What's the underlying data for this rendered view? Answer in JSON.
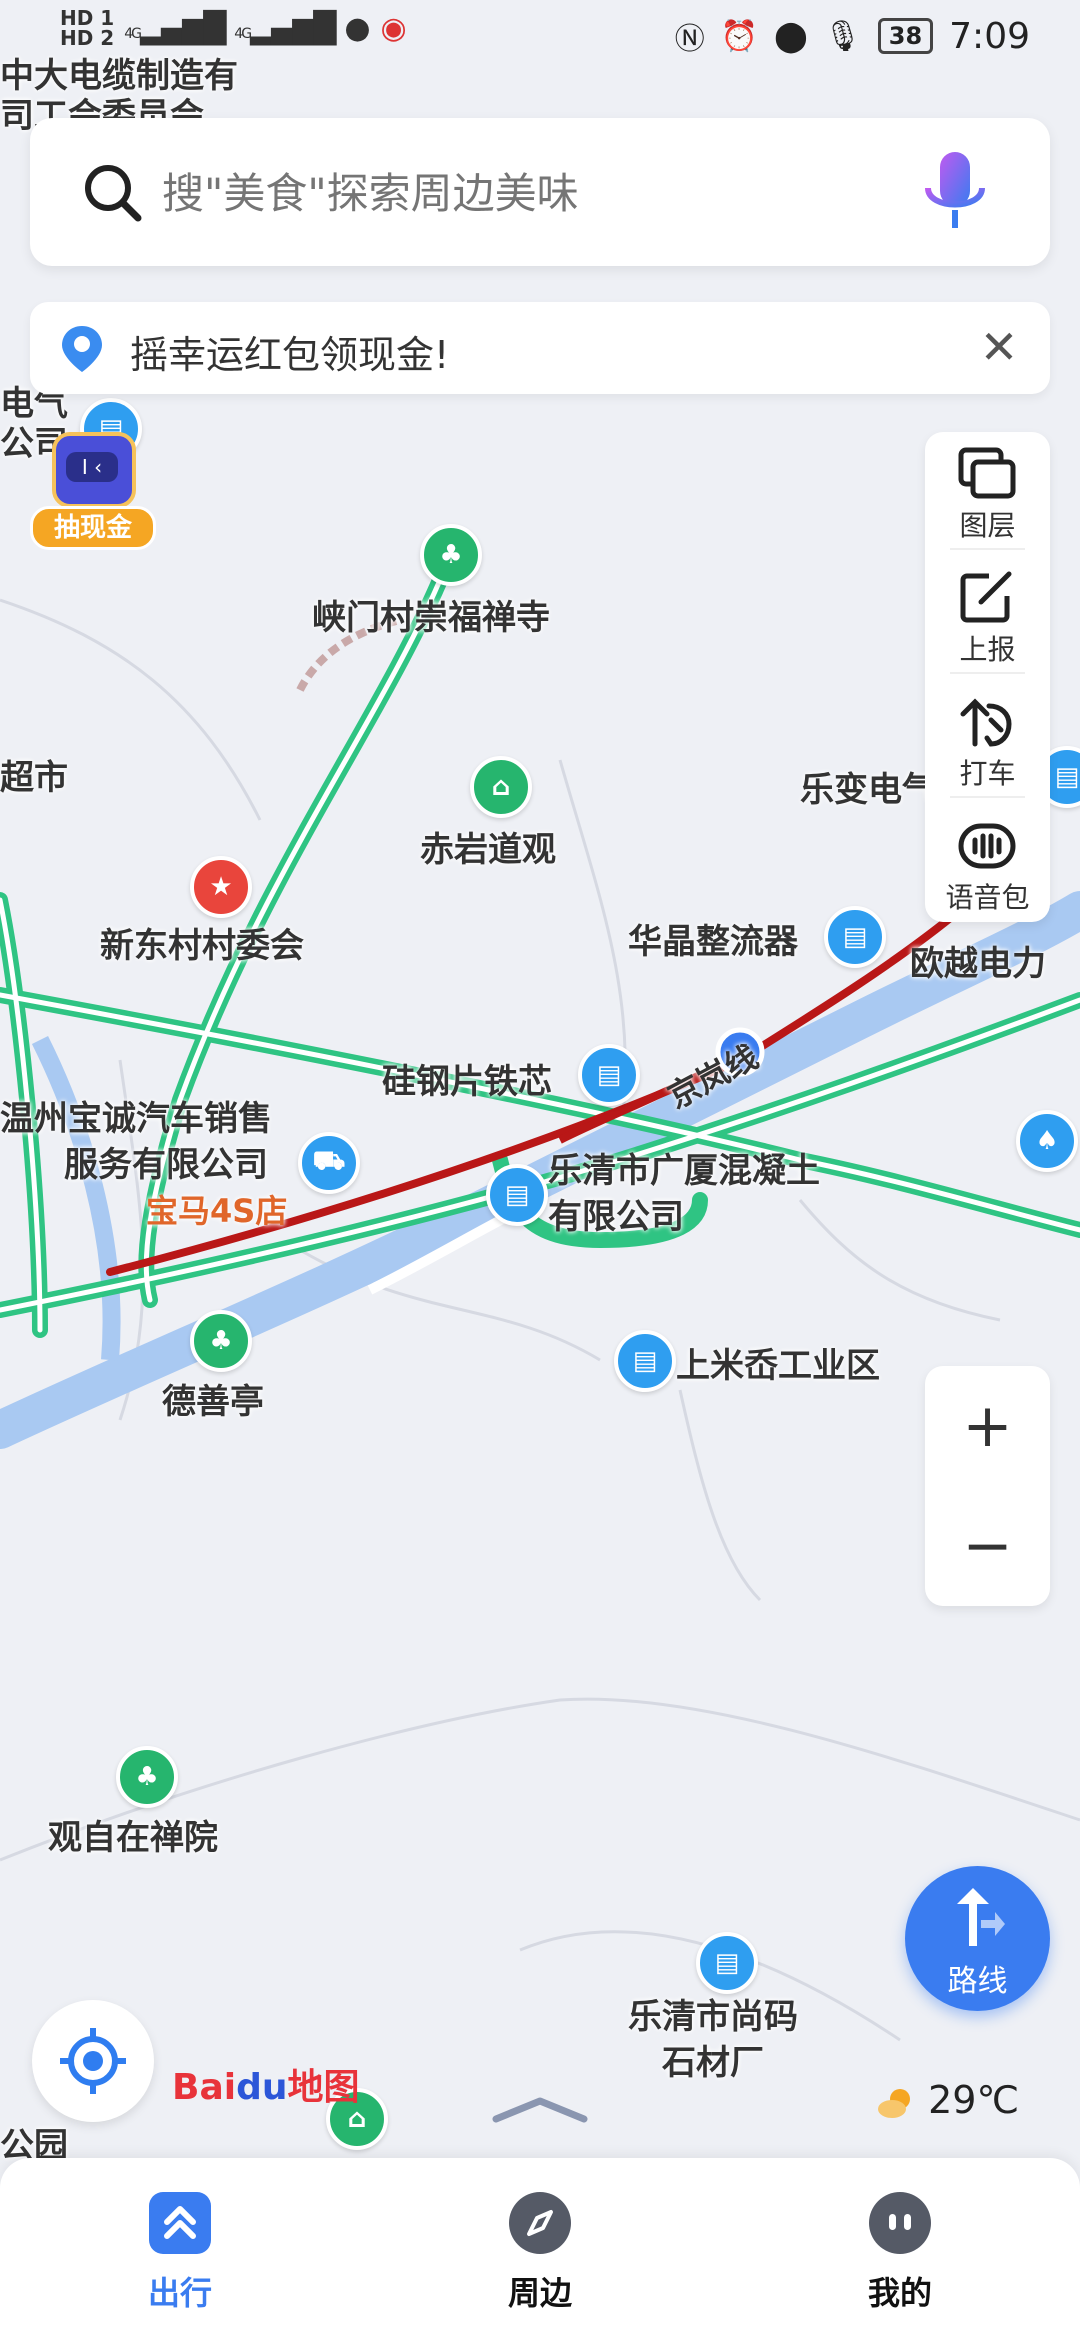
{
  "status_bar": {
    "left_indicators": [
      "HD 1",
      "HD 2",
      "4G",
      "4G"
    ],
    "battery": "38",
    "time": "7:09"
  },
  "search": {
    "placeholder": "搜\"美食\"探索周边美味",
    "search_icon": "search-icon",
    "voice_icon": "microphone-icon"
  },
  "promo": {
    "text": "摇幸运红包领现金!",
    "close_icon": "close-icon"
  },
  "tools": [
    {
      "label": "图层",
      "icon": "layers-icon"
    },
    {
      "label": "上报",
      "icon": "edit-icon"
    },
    {
      "label": "打车",
      "icon": "taxi-icon"
    },
    {
      "label": "语音包",
      "icon": "voice-pack-icon"
    }
  ],
  "zoom": {
    "in": "+",
    "out": "−"
  },
  "route_button": {
    "label": "路线"
  },
  "weather": {
    "temp": "29℃",
    "icon": "partly-sunny-icon"
  },
  "logo": {
    "brand_a": "Bai",
    "brand_b": "du",
    "brand_c": "地图"
  },
  "promo_badge": {
    "label": "抽现金"
  },
  "map_labels": {
    "top_left": [
      "中大电缆制造有",
      "司工会委员会"
    ],
    "electric": [
      "电气",
      "公司"
    ],
    "market": "超市",
    "xiamen_temple": "峡门村崇福禅寺",
    "chiyan": "赤岩道观",
    "xindong": "新东村村委会",
    "huajing": "华晶整流器",
    "lebian": "乐变电气",
    "ouyue": "欧越电力",
    "guigang": "硅钢片铁芯",
    "road": "京岚线",
    "baocheng": [
      "温州宝诚汽车销售",
      "服务有限公司"
    ],
    "bmw": "宝马4S店",
    "guangsha": [
      "乐清市广厦混凝土",
      "有限公司"
    ],
    "deshan": "德善亭",
    "shangmi": "上米岙工业区",
    "guanzizai": "观自在禅院",
    "shangma": [
      "乐清市尚码",
      "石材厂"
    ],
    "park": "公园"
  },
  "bottom_nav": [
    {
      "label": "出行",
      "icon": "travel-icon",
      "active": true
    },
    {
      "label": "周边",
      "icon": "compass-icon",
      "active": false
    },
    {
      "label": "我的",
      "icon": "profile-icon",
      "active": false
    }
  ],
  "colors": {
    "accent": "#3a7cf0",
    "road_green": "#2fc483",
    "traffic_red": "#c81e1e",
    "river": "#9cc4f2",
    "map_bg": "#eef0f5"
  }
}
